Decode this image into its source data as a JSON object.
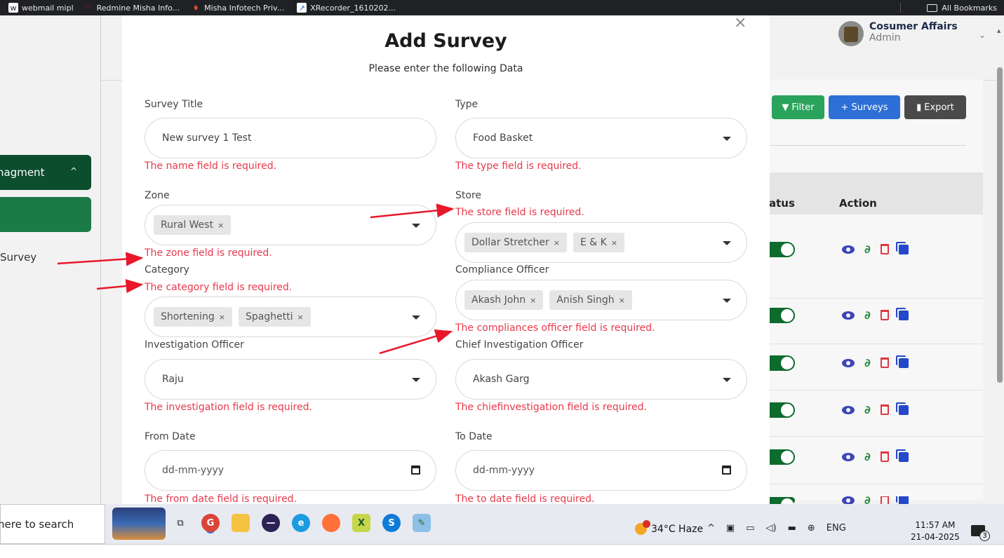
{
  "bookmarks": {
    "items": [
      {
        "label": "webmail mipl",
        "icon": "webmail-icon",
        "color": "#ffffff"
      },
      {
        "label": "Redmine Misha Info...",
        "icon": "redmine-icon",
        "color": "#b3262b"
      },
      {
        "label": "Misha Infotech Priv...",
        "icon": "misha-icon",
        "color": "#e24a2b"
      },
      {
        "label": "XRecorder_1610202...",
        "icon": "xrecorder-icon",
        "color": "#2d6fd6"
      }
    ],
    "all_bookmarks": "All Bookmarks"
  },
  "app": {
    "user_name": "Cosumer Affairs",
    "user_role": "Admin",
    "sidebar_mgmt_label": "nagment",
    "sidebar_survey_label": "Survey",
    "buttons": {
      "filter": "Filter",
      "add": "+ Surveys",
      "export": "Export"
    },
    "table_headers": {
      "status": "atus",
      "action": "Action"
    },
    "rows": 6
  },
  "modal": {
    "title": "Add Survey",
    "subtitle": "Please enter the following Data",
    "close_symbol": "×",
    "fields": {
      "survey_title": {
        "label": "Survey Title",
        "value": "New survey 1 Test",
        "error": "The name field is required."
      },
      "type": {
        "label": "Type",
        "value": "Food Basket",
        "error": "The type field is required."
      },
      "zone": {
        "label": "Zone",
        "tags": [
          "Rural West"
        ],
        "error": "The zone field is required."
      },
      "store": {
        "label": "Store",
        "tags": [
          "Dollar Stretcher",
          "E & K"
        ],
        "error": "The store field is required."
      },
      "category": {
        "label": "Category",
        "tags": [
          "Shortening",
          "Spaghetti"
        ],
        "error": "The category field is required."
      },
      "compliance_officer": {
        "label": "Compliance Officer",
        "tags": [
          "Akash John",
          "Anish Singh"
        ],
        "error": "The compliances officer field is required."
      },
      "investigation_officer": {
        "label": "Investigation Officer",
        "value": "Raju",
        "error": "The investigation field is required."
      },
      "chief_investigation_officer": {
        "label": "Chief Investigation Officer",
        "value": "Akash Garg",
        "error": "The chiefinvestigation field is required."
      },
      "from_date": {
        "label": "From Date",
        "placeholder": "dd-mm-yyyy",
        "error": "The from date field is required."
      },
      "to_date": {
        "label": "To Date",
        "placeholder": "dd-mm-yyyy",
        "error": "The to date field is required."
      }
    },
    "tag_remove_symbol": "×"
  },
  "taskbar": {
    "search_text": "here to search",
    "weather": "34°C  Haze",
    "language": "ENG",
    "time": "11:57 AM",
    "date": "21-04-2025",
    "notification_count": "3",
    "apps": [
      "task-view-icon",
      "chrome-icon",
      "file-explorer-icon",
      "eclipse-icon",
      "edge-icon",
      "firefox-icon",
      "excel-icon",
      "skype-icon",
      "notepad-icon"
    ]
  },
  "colors": {
    "error": "#e8384a",
    "sidebar_dark": "#0b4d2c",
    "sidebar_active": "#1c7a46",
    "filter_button": "#2aa35c",
    "add_button": "#2d6fd6",
    "export_button": "#4a4a4a",
    "annotation_arrow": "#e8182a"
  }
}
